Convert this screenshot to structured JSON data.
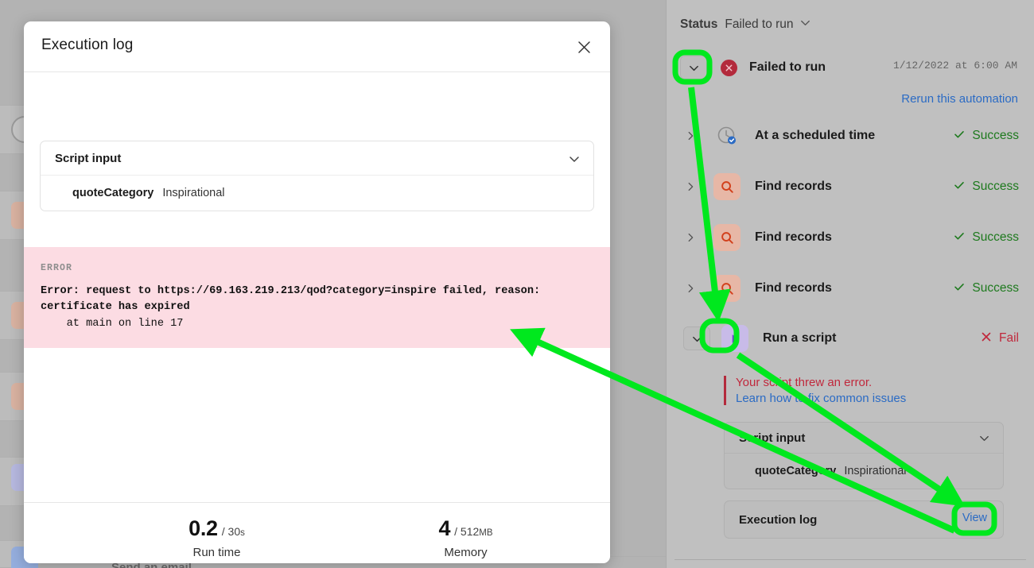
{
  "modal": {
    "title": "Execution log",
    "close_icon": "close-icon",
    "script_input": {
      "header": "Script input",
      "chevron_icon": "chevron-down-icon",
      "param_key": "quoteCategory",
      "param_value": "Inspirational"
    },
    "error": {
      "label": "ERROR",
      "message": "Error: request to https://69.163.219.213/qod?category=inspire failed, reason: certificate has expired",
      "trace": "    at main on line 17"
    },
    "footer": {
      "stats": [
        {
          "value": "0.2",
          "max": "/ 30s",
          "max_num": "/ 30",
          "max_unit": "s",
          "caption": "Run time"
        },
        {
          "value": "4",
          "max": "/ 512MB",
          "max_num": "/ 512",
          "max_unit": "MB",
          "caption": "Memory"
        }
      ]
    }
  },
  "right_panel": {
    "status_label": "Status",
    "status_value": "Failed to run",
    "status_chevron_icon": "chevron-down-icon",
    "run": {
      "chevron_icon": "chevron-down-icon",
      "state_icon": "error-circle-icon",
      "title": "Failed to run",
      "timestamp": "1/12/2022 at 6:00 AM",
      "rerun_label": "Rerun this automation"
    },
    "steps": [
      {
        "chevron_icon": "chevron-right-icon",
        "icon": "clock-check-icon",
        "label": "At a scheduled time",
        "status": "Success",
        "status_icon": "check-icon",
        "state": "success"
      },
      {
        "chevron_icon": "chevron-right-icon",
        "icon": "search-records-icon",
        "label": "Find records",
        "status": "Success",
        "status_icon": "check-icon",
        "state": "success"
      },
      {
        "chevron_icon": "chevron-right-icon",
        "icon": "search-records-icon",
        "label": "Find records",
        "status": "Success",
        "status_icon": "check-icon",
        "state": "success"
      },
      {
        "chevron_icon": "chevron-right-icon",
        "icon": "search-records-icon",
        "label": "Find records",
        "status": "Success",
        "status_icon": "check-icon",
        "state": "success"
      },
      {
        "chevron_icon": "chevron-down-icon",
        "icon": "play-script-icon",
        "label": "Run a script",
        "status": "Fail",
        "status_icon": "x-icon",
        "state": "fail"
      }
    ],
    "error_note": {
      "line1": "Your script threw an error.",
      "line2": "Learn how to fix common issues"
    },
    "script_input": {
      "header": "Script input",
      "chevron_icon": "chevron-down-icon",
      "param_key": "quoteCategory",
      "param_value": "Inspirational"
    },
    "execution_log": {
      "label": "Execution log",
      "view_label": "View"
    }
  },
  "background": {
    "partial_step_label": "Send an email"
  },
  "annotations": {
    "highlight_color": "#00e81e",
    "targets": [
      "run-chevron",
      "script-chevron",
      "view-button"
    ]
  },
  "colors": {
    "accent_link": "#2b6bc4",
    "success": "#1e7a1e",
    "fail": "#c0283c",
    "error_bg": "#fcdce3",
    "highlight": "#00e81e"
  }
}
